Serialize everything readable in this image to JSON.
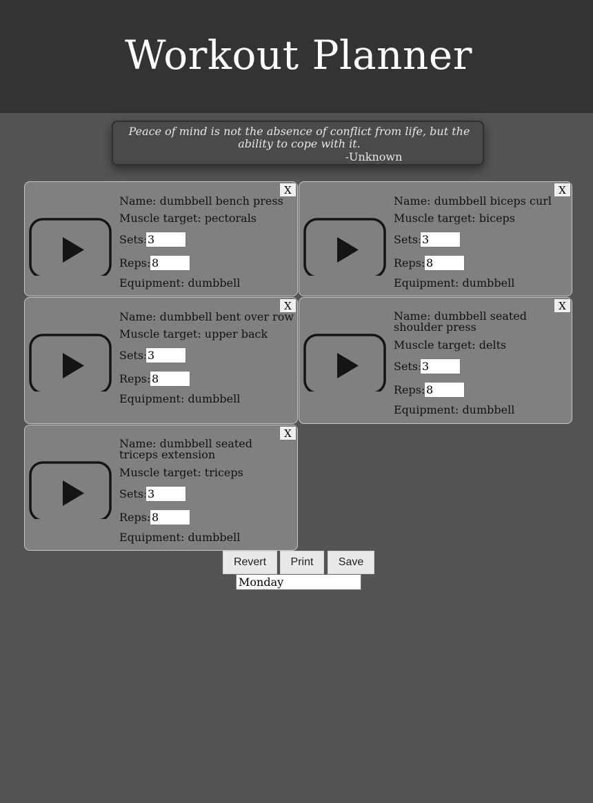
{
  "header": {
    "title": "Workout Planner"
  },
  "quote": {
    "text": "Peace of mind is not the absence of conflict from life, but the ability to cope with it.",
    "author": "-Unknown"
  },
  "exercise_labels": {
    "name_prefix": "Name: ",
    "target_prefix": "Muscle target: ",
    "sets_label": "Sets:",
    "reps_label": "Reps:",
    "equipment_prefix": "Equipment: ",
    "remove": "X"
  },
  "exercises": [
    {
      "name": "dumbbell bench press",
      "target": "pectorals",
      "sets": "3",
      "reps": "8",
      "equipment": "dumbbell",
      "thumb_icon": "play-video-icon"
    },
    {
      "name": "dumbbell biceps curl",
      "target": "biceps",
      "sets": "3",
      "reps": "8",
      "equipment": "dumbbell",
      "thumb_icon": "play-video-icon"
    },
    {
      "name": "dumbbell bent over row",
      "target": "upper back",
      "sets": "3",
      "reps": "8",
      "equipment": "dumbbell",
      "thumb_icon": "play-video-icon"
    },
    {
      "name": "dumbbell seated shoulder press",
      "target": "delts",
      "sets": "3",
      "reps": "8",
      "equipment": "dumbbell",
      "thumb_icon": "play-video-icon"
    },
    {
      "name": "dumbbell seated triceps extension",
      "target": "triceps",
      "sets": "3",
      "reps": "8",
      "equipment": "dumbbell",
      "thumb_icon": "play-video-icon"
    }
  ],
  "actions": {
    "revert": "Revert",
    "print": "Print",
    "save": "Save"
  },
  "day": {
    "value": "Monday"
  }
}
